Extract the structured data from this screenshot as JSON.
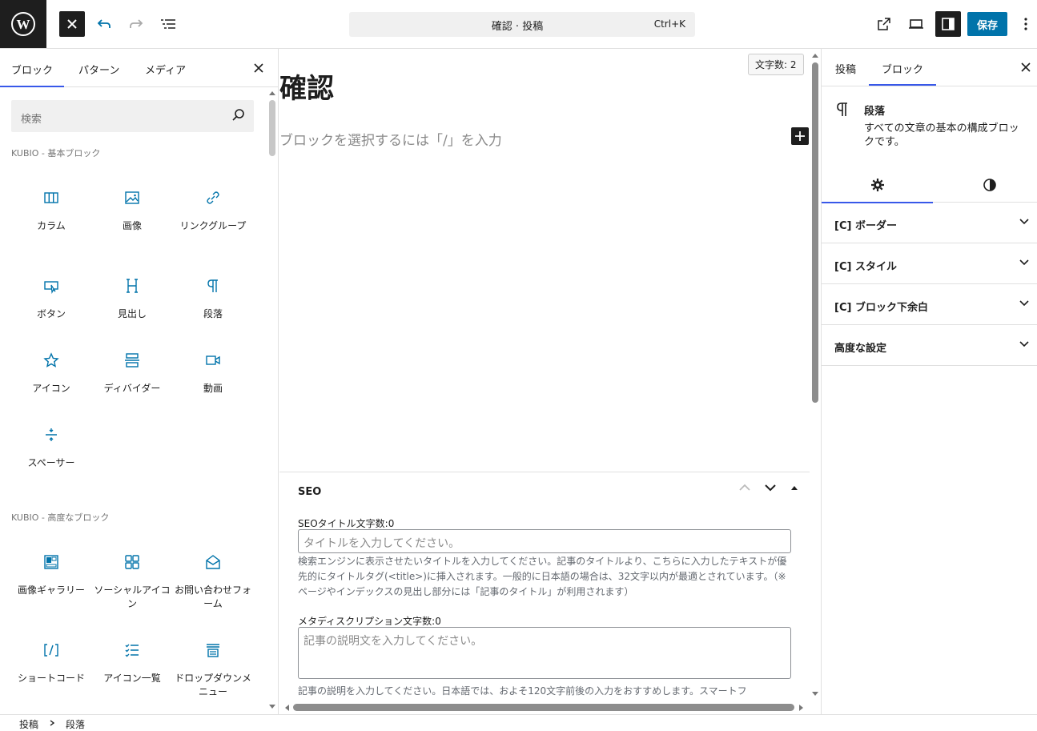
{
  "header": {
    "command_title": "確認 · 投稿",
    "command_shortcut": "Ctrl+K",
    "save_label": "保存"
  },
  "inserter": {
    "tabs": [
      "ブロック",
      "パターン",
      "メディア"
    ],
    "search_placeholder": "検索",
    "categories": [
      {
        "name": "KUBIO - 基本ブロック",
        "blocks": [
          {
            "label": "カラム",
            "icon": "columns-icon"
          },
          {
            "label": "画像",
            "icon": "image-icon"
          },
          {
            "label": "リンクグループ",
            "icon": "link-icon"
          },
          {
            "label": "ボタン",
            "icon": "button-icon"
          },
          {
            "label": "見出し",
            "icon": "heading-icon"
          },
          {
            "label": "段落",
            "icon": "paragraph-icon"
          },
          {
            "label": "アイコン",
            "icon": "star-icon"
          },
          {
            "label": "ディバイダー",
            "icon": "divider-icon"
          },
          {
            "label": "動画",
            "icon": "video-icon"
          },
          {
            "label": "スペーサー",
            "icon": "spacer-icon"
          }
        ]
      },
      {
        "name": "KUBIO - 高度なブロック",
        "blocks": [
          {
            "label": "画像ギャラリー",
            "icon": "gallery-icon"
          },
          {
            "label": "ソーシャルアイコン",
            "icon": "social-icon"
          },
          {
            "label": "お問い合わせフォーム",
            "icon": "contact-form-icon"
          },
          {
            "label": "ショートコード",
            "icon": "shortcode-icon"
          },
          {
            "label": "アイコン一覧",
            "icon": "icon-list-icon"
          },
          {
            "label": "ドロップダウンメニュー",
            "icon": "dropdown-menu-icon"
          }
        ]
      }
    ]
  },
  "editor": {
    "word_count": "文字数: 2",
    "title": "確認",
    "placeholder": "ブロックを選択するには「/」を入力"
  },
  "seo": {
    "heading": "SEO",
    "title_label": "SEOタイトル文字数:0",
    "title_placeholder": "タイトルを入力してください。",
    "title_help": "検索エンジンに表示させたいタイトルを入力してください。記事のタイトルより、こちらに入力したテキストが優先的にタイトルタグ(<title>)に挿入されます。一般的に日本語の場合は、32文字以内が最適とされています。（※ページやインデックスの見出し部分には「記事のタイトル」が利用されます）",
    "desc_label": "メタディスクリプション文字数:0",
    "desc_placeholder": "記事の説明文を入力してください。",
    "desc_help": "記事の説明を入力してください。日本語では、およそ120文字前後の入力をおすすめします。スマートフ"
  },
  "sidebar": {
    "tabs": [
      "投稿",
      "ブロック"
    ],
    "block_name": "段落",
    "block_desc": "すべての文章の基本の構成ブロックです。",
    "panels": [
      "[C] ボーダー",
      "[C] スタイル",
      "[C] ブロック下余白",
      "高度な設定"
    ]
  },
  "breadcrumb": [
    "投稿",
    "段落"
  ],
  "colors": {
    "accent": "#3858e9",
    "save": "#0073aa",
    "block_icon": "#0073aa"
  }
}
